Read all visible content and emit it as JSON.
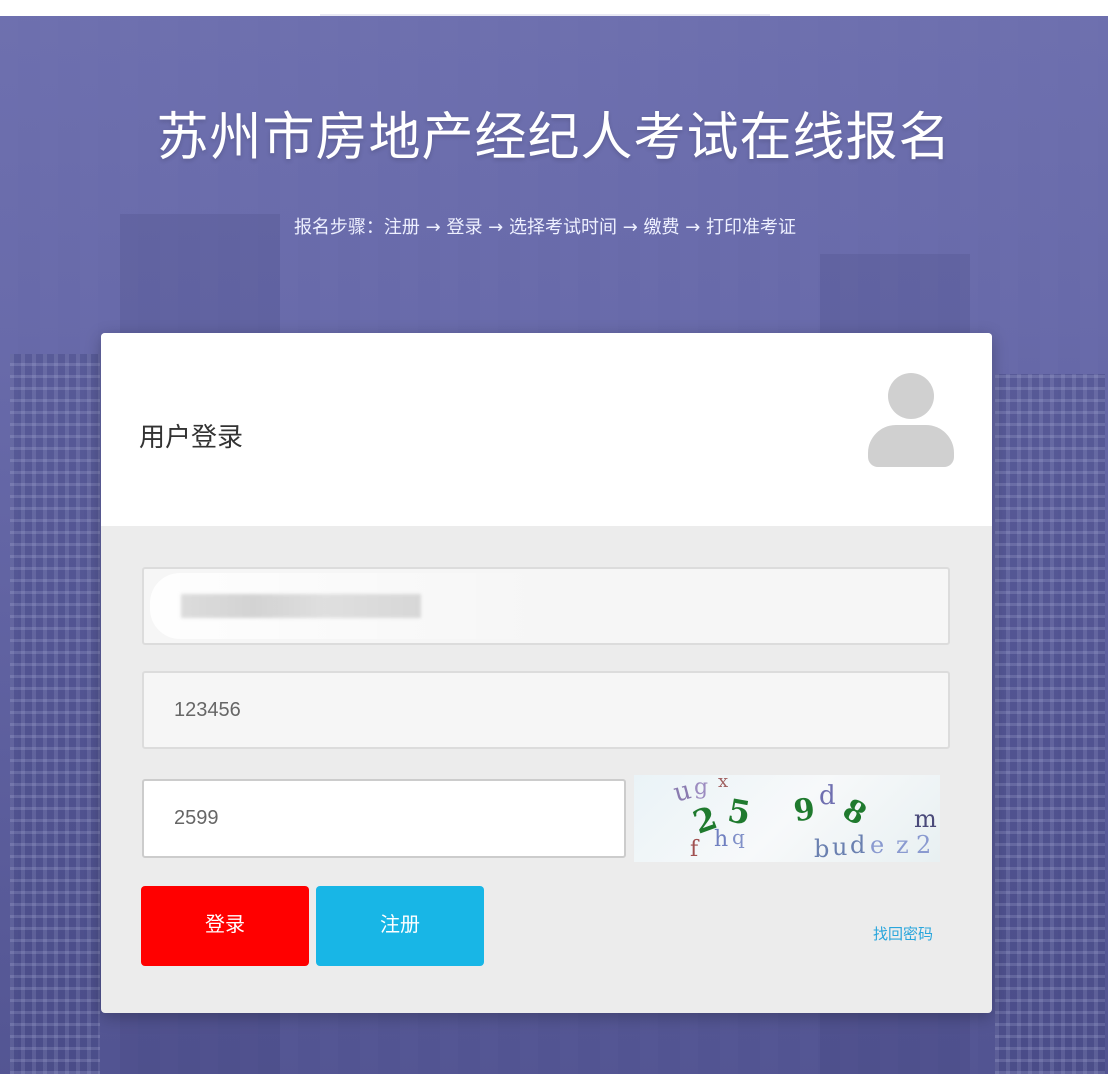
{
  "page": {
    "title": "苏州市房地产经纪人考试在线报名",
    "steps": "报名步骤：注册 → 登录 → 选择考试时间 → 缴费 → 打印准考证"
  },
  "login": {
    "title": "用户登录",
    "username_value": "",
    "password_value": "123456",
    "captcha_value": "2599",
    "login_label": "登录",
    "register_label": "注册",
    "forgot_label": "找回密码"
  },
  "captcha_image": {
    "main_chars": [
      "2",
      "5",
      "9",
      "8"
    ],
    "noise_chars": [
      "u",
      "g",
      "x",
      "d",
      "m",
      "h",
      "q",
      "f",
      "b",
      "u",
      "d",
      "e",
      "z",
      "2"
    ]
  },
  "colors": {
    "login_button": "#ff0000",
    "register_button": "#18b6e6",
    "link": "#2aa6dc",
    "background": "#6a6cab"
  },
  "icons": {
    "avatar": "user-silhouette-icon"
  }
}
